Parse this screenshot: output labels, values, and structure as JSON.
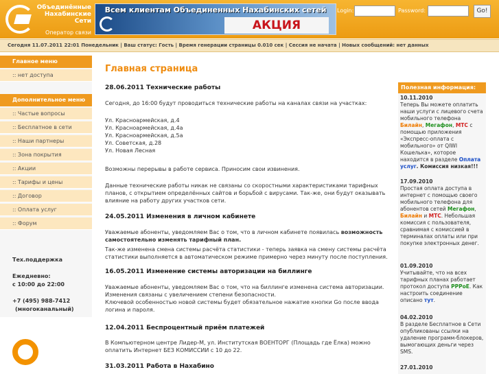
{
  "header": {
    "logo_l1": "Объединённые",
    "logo_l2": "Нахабинские",
    "logo_l3": "Сети",
    "logo_sub": "Оператор связи",
    "banner_top": "Всем клиентам Объединенных Нахабинских сетей",
    "banner_sale": "АКЦИЯ",
    "login_label": "Login:",
    "password_label": "Password:",
    "login_value": "",
    "password_value": "",
    "go_label": "Go!"
  },
  "statusbar": "Сегодня 11.07.2011 22:01 Понедельник | Ваш статус: Гость | Время генерации страницы 0.010 сек | Сессия не начата | Новых сообщений: нет данных",
  "sidebar": {
    "main_menu": "Главное меню",
    "main_items": [
      ":: нет доступа"
    ],
    "extra_menu": "Дополнительное меню",
    "extra_items": [
      ":: Частые вопросы",
      ":: Бесплатное в сети",
      ":: Наши партнеры",
      ":: Зона покрытия",
      ":: Акции",
      ":: Тарифы и цены",
      ":: Договор",
      ":: Оплата услуг",
      ":: Форум"
    ],
    "support": "Тех.поддержка",
    "daily": "Ежедневно:",
    "hours": "с 10:00 до 22:00",
    "phone": "+7 (495) 988-7412",
    "multichannel": "(многоканальный)"
  },
  "main": {
    "title": "Главная страница",
    "n1_title": "28.06.2011 Технические работы",
    "n1_intro": "Сегодня, до 16:00 будут проводиться технические работы на каналах связи на участках:",
    "n1_streets": [
      "Ул. Красноармейская, д.4",
      "Ул. Красноармейская, д.4а",
      "Ул. Красноармейская, д.5а",
      "Ул. Советская, д.28",
      "Ул. Новая Лесная"
    ],
    "n1_p2": "Возможны перерывы в работе сервиса. Приносим свои извинения.",
    "n1_p3": "Данные технические работы никак не связаны со скоростными характеристиками тарифных планов, с открытием определённых сайтов и борьбой с вирусами. Так-же, они будут оказывать влияние на работу других участков сети.",
    "n2_title": "24.05.2011 Изменения в личном кабинете",
    "n2_p1a": "Уважаемые абоненты, уведомляем Вас о том, что в личном кабинете появилась ",
    "n2_p1b": "возможность самостоятельно изменять тарифный план.",
    "n2_p2": "Так-же изменена смена системы расчёта статистики - теперь заявка на смену системы расчёта статистики выполняется в автоматическом режиме примерно через минуту после поступления.",
    "n3_title": "16.05.2011 Изменение системы авторизации на биллинге",
    "n3_p1": "Уважаемые абоненты, уведомляем Вас о том, что на биллинге изменена система авторизации.",
    "n3_p2": "Изменения связаны с увеличением степени безопасности.",
    "n3_p3": "Ключевой особенностью новой системы будет обязательное нажатие кнопки Go после ввода логина и пароля.",
    "n4_title": "12.04.2011 Беспроцентный приём платежей",
    "n4_p1": "В Компьютерном центре Лидер-М, ул. Институтская ВОЕНТОРГ (Площадь где Ёлка) можно оплатить Интернет БЕЗ КОМИССИИ с 10 до 22.",
    "n5_title": "31.03.2011 Работа в Нахабино"
  },
  "right": {
    "header": "Полезная информация:",
    "i1_date": "10.11.2010",
    "i2_date": "17.09.2010",
    "i3_date": "01.09.2010",
    "i4_date": "04.02.2010",
    "i5_date": "27.01.2010",
    "w_beeline": "Билайн",
    "w_megafon": "Мегафон",
    "w_mts": "МТС",
    "w_oplata": "Оплата услуг",
    "w_pppoe": "PPPoE",
    "w_tut": "тут",
    "i1_a": "Теперь Вы можете оплатить наши услуги с лицевого счета мобильного телефона ",
    "i1_b": ", ",
    "i1_c": " с помощью приложения «Экспресс-оплата с мобильного» от QIWI Кошелька», которое находится в разделе ",
    "i1_d": ". Комиссия низкая!!!",
    "i2_a": "Простая оплата доступа в интернет с помощью своего мобильного телефона для абонентов сетей ",
    "i2_b": ", ",
    "i2_c": " и ",
    "i2_d": ". Небольшая комиссия с пользователя, сравнимая с комиссией в терминалах оплаты или при покупке электронных денег.",
    "i3_a": "Учитывайте, что на всех тарифных планах работает протокол доступа ",
    "i3_b": ". Как настроить соединение описано ",
    "i3_c": ".",
    "i4_a": "В разделе Бесплатное в Сети опубликованы ссылки на удаление программ-блокеров, вымогающих деньги через SMS."
  }
}
